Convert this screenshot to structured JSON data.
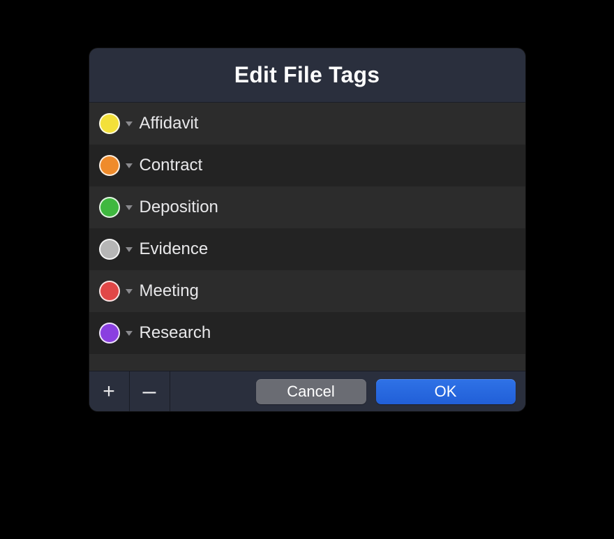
{
  "dialog": {
    "title": "Edit File Tags"
  },
  "tags": [
    {
      "label": "Affidavit",
      "color": "#f3e03a"
    },
    {
      "label": "Contract",
      "color": "#ef8b2b"
    },
    {
      "label": "Deposition",
      "color": "#3fb83f"
    },
    {
      "label": "Evidence",
      "color": "#b6b6b6"
    },
    {
      "label": "Meeting",
      "color": "#e04747"
    },
    {
      "label": "Research",
      "color": "#8a3fe0"
    }
  ],
  "footer": {
    "add_icon": "+",
    "remove_icon": "–",
    "cancel_label": "Cancel",
    "ok_label": "OK"
  }
}
